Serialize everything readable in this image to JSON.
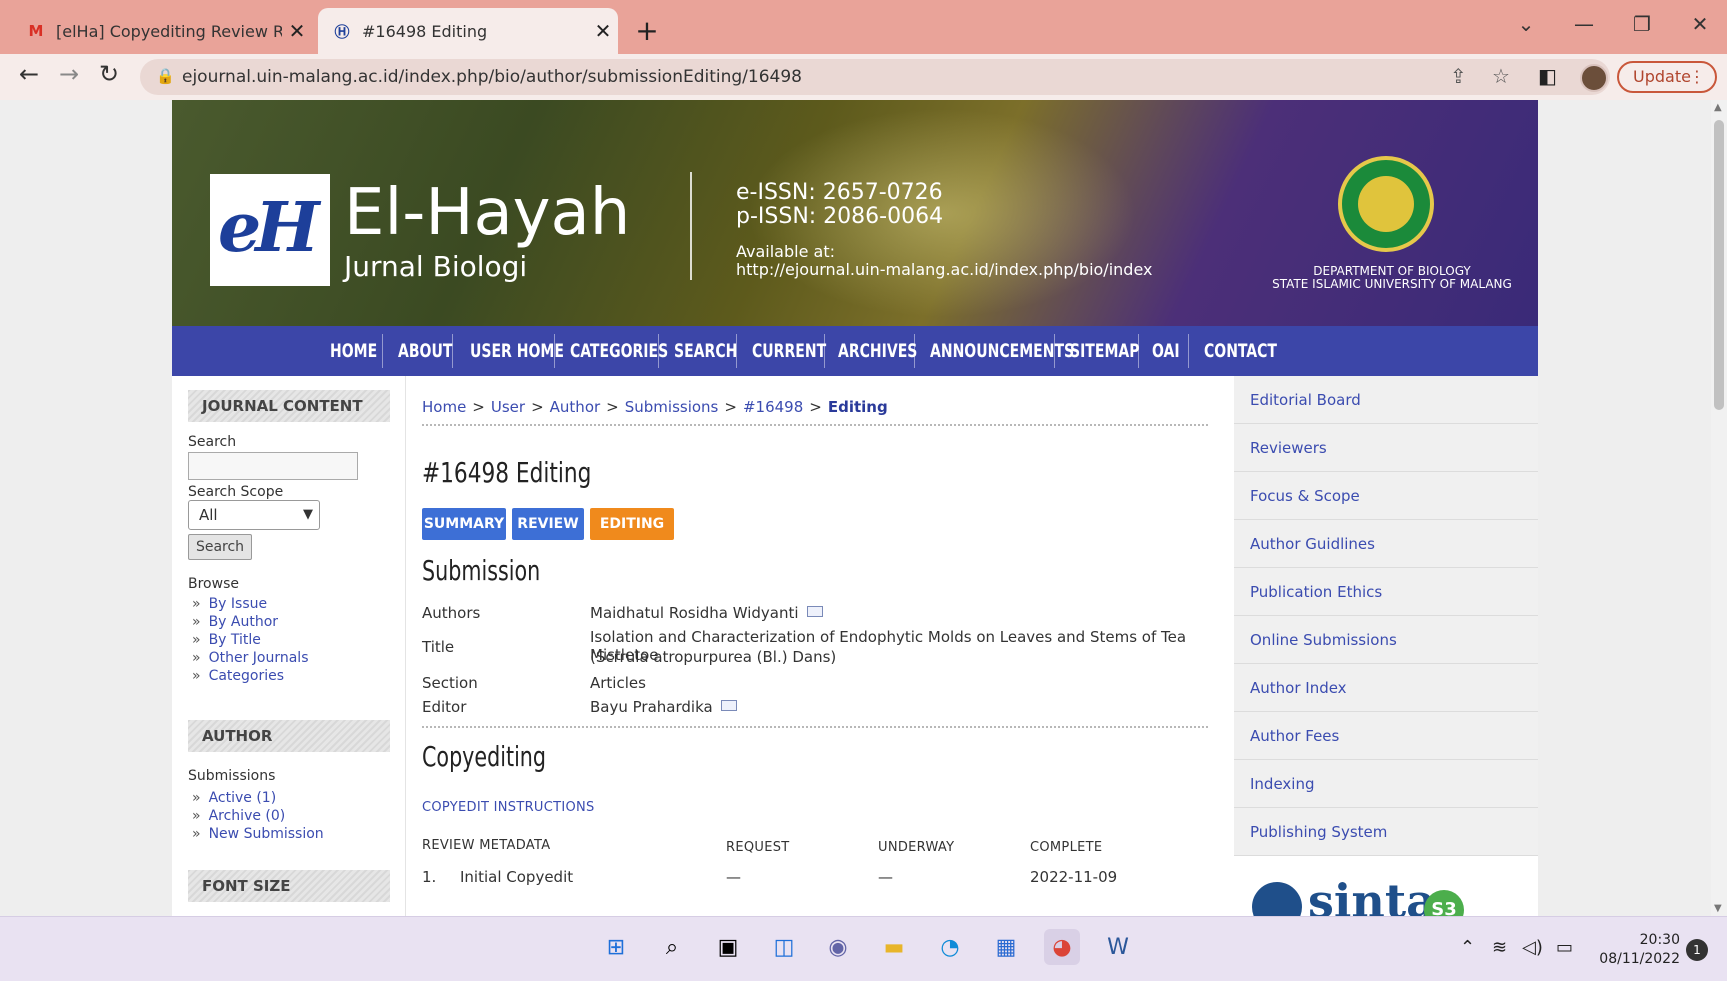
{
  "browser": {
    "tabs": [
      {
        "title": "[elHa] Copyediting Review Reque",
        "icon": "gmail-icon"
      },
      {
        "title": "#16498 Editing",
        "icon": "site-favicon"
      }
    ],
    "address": "ejournal.uin-malang.ac.id/index.php/bio/author/submissionEditing/16498",
    "update_label": "Update"
  },
  "header": {
    "brand": "El-Hayah",
    "brand_sub": "Jurnal Biologi",
    "eissn": "e-ISSN: 2657-0726",
    "pissn": "p-ISSN: 2086-0064",
    "available_label": "Available at:",
    "available_url": "http://ejournal.uin-malang.ac.id/index.php/bio/index",
    "dept_line1": "DEPARTMENT OF BIOLOGY",
    "dept_line2": "STATE ISLAMIC UNIVERSITY OF MALANG"
  },
  "nav": [
    "HOME",
    "ABOUT",
    "USER HOME",
    "CATEGORIES",
    "SEARCH",
    "CURRENT",
    "ARCHIVES",
    "ANNOUNCEMENTS",
    "SITEMAP",
    "OAI",
    "CONTACT"
  ],
  "sidebar": {
    "journal_content": "JOURNAL CONTENT",
    "search_label": "Search",
    "scope_label": "Search Scope",
    "scope_value": "All",
    "search_button": "Search",
    "browse_label": "Browse",
    "browse_links": [
      "By Issue",
      "By Author",
      "By Title",
      "Other Journals",
      "Categories"
    ],
    "author_head": "AUTHOR",
    "submissions_label": "Submissions",
    "submission_links": [
      "Active (1)",
      "Archive (0)",
      "New Submission"
    ],
    "font_size_head": "FONT SIZE"
  },
  "breadcrumb": [
    "Home",
    "User",
    "Author",
    "Submissions",
    "#16498",
    "Editing"
  ],
  "main": {
    "title": "#16498 Editing",
    "tabs": [
      "SUMMARY",
      "REVIEW",
      "EDITING"
    ],
    "submission_heading": "Submission",
    "labels": {
      "authors": "Authors",
      "title": "Title",
      "section": "Section",
      "editor": "Editor"
    },
    "authors": "Maidhatul Rosidha Widyanti",
    "title_line1": "Isolation and Characterization of Endophytic Molds on Leaves and Stems of Tea Mistletoe",
    "title_line2": "(Scrrula atropurpurea (Bl.) Dans)",
    "section": "Articles",
    "editor": "Bayu Prahardika",
    "copyediting_heading": "Copyediting",
    "copyedit_instructions": "COPYEDIT INSTRUCTIONS",
    "review_metadata": "REVIEW METADATA",
    "col_request": "REQUEST",
    "col_underway": "UNDERWAY",
    "col_complete": "COMPLETE",
    "row1_num": "1.",
    "row1_label": "Initial Copyedit",
    "row1_request": "—",
    "row1_underway": "—",
    "row1_complete": "2022-11-09"
  },
  "right_links": [
    "Editorial Board",
    "Reviewers",
    "Focus & Scope",
    "Author Guidlines",
    "Publication Ethics",
    "Online Submissions",
    "Author Index",
    "Author Fees",
    "Indexing",
    "Publishing System"
  ],
  "sinta": {
    "word": "sinta",
    "badge": "S3"
  },
  "taskbar": {
    "time": "20:30",
    "date": "08/11/2022",
    "notifications": "1"
  },
  "colors": {
    "nav": "#3c46a8",
    "tab_blue": "#3d6fd6",
    "tab_orange": "#f08a1c",
    "link": "#3b4cb0"
  }
}
